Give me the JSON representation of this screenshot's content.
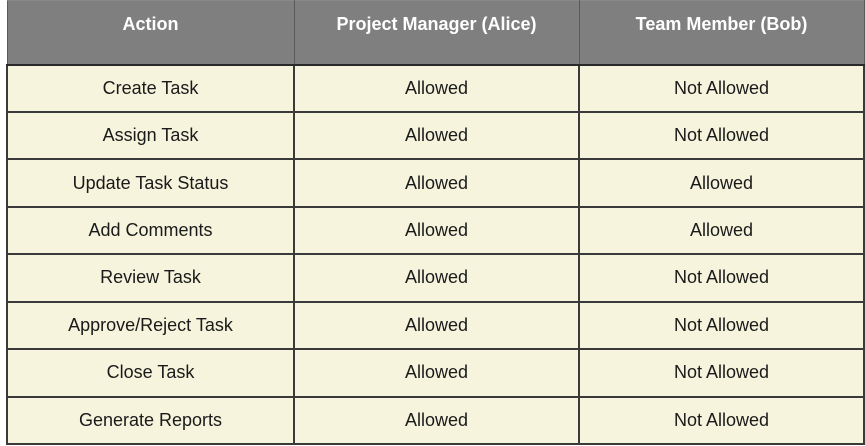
{
  "table": {
    "headers": [
      "Action",
      "Project Manager (Alice)",
      "Team Member (Bob)"
    ],
    "rows": [
      [
        "Create Task",
        "Allowed",
        "Not Allowed"
      ],
      [
        "Assign Task",
        "Allowed",
        "Not Allowed"
      ],
      [
        "Update Task Status",
        "Allowed",
        "Allowed"
      ],
      [
        "Add Comments",
        "Allowed",
        "Allowed"
      ],
      [
        "Review Task",
        "Allowed",
        "Not Allowed"
      ],
      [
        "Approve/Reject Task",
        "Allowed",
        "Not Allowed"
      ],
      [
        "Close Task",
        "Allowed",
        "Not Allowed"
      ],
      [
        "Generate Reports",
        "Allowed",
        "Not Allowed"
      ]
    ]
  },
  "colors": {
    "header_background": "#7f7f7f",
    "header_text": "#ffffff",
    "cell_background": "#f6f4dd",
    "cell_text": "#1a1a1a",
    "grid_lines": "#3a3a3a"
  }
}
